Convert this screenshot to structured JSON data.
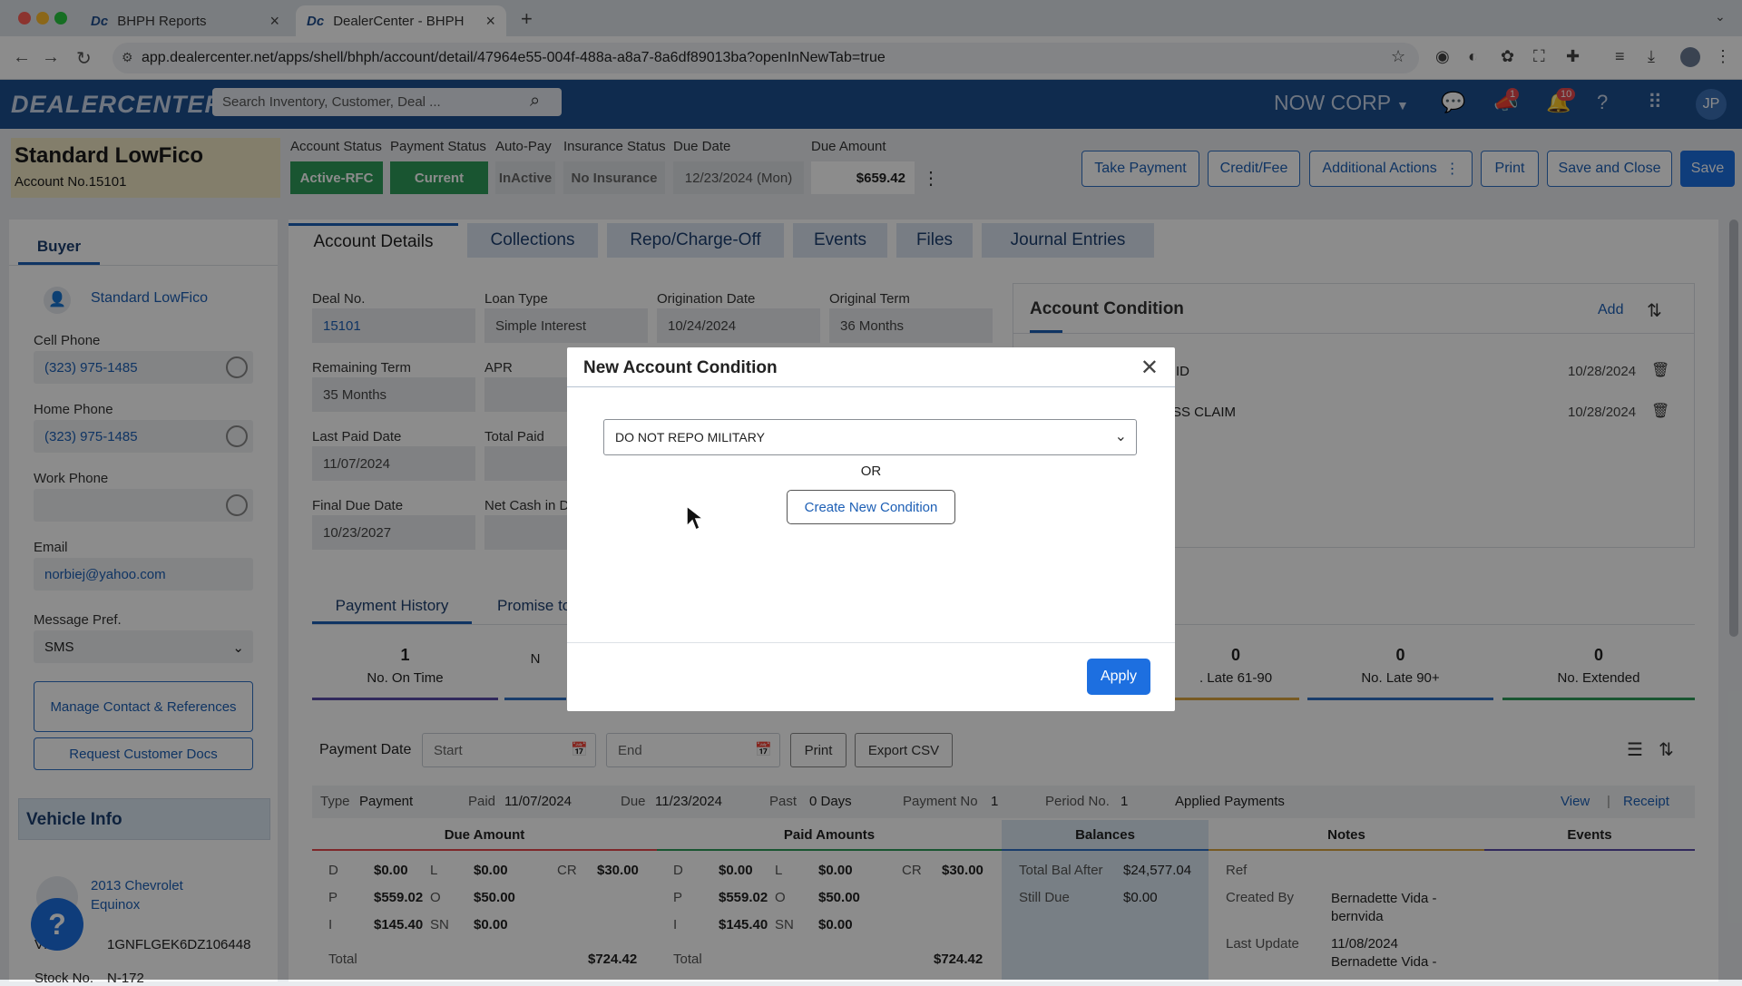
{
  "browser": {
    "tabs": [
      {
        "label": "BHPH Reports",
        "favicon": "Dc"
      },
      {
        "label": "DealerCenter - BHPH",
        "favicon": "Dc"
      }
    ],
    "url": "app.dealercenter.net/apps/shell/bhph/account/detail/47964e55-004f-488a-a8a7-8a6df89013ba?openInNewTab=true"
  },
  "app": {
    "logo": "DEALERCENTER",
    "search_placeholder": "Search Inventory, Customer, Deal ...",
    "company": "NOW CORP",
    "announcements_badge": "1",
    "notifications_badge": "10",
    "user_initials": "JP"
  },
  "account": {
    "name": "Standard LowFico",
    "number_label": "Account No.15101",
    "status_labels": [
      "Account Status",
      "Payment Status",
      "Auto-Pay",
      "Insurance Status",
      "Due Date",
      "Due Amount"
    ],
    "account_status": "Active-RFC",
    "payment_status": "Current",
    "auto_pay": "InActive",
    "insurance_status": "No Insurance",
    "due_date": "12/23/2024 (Mon)",
    "due_amount": "$659.42",
    "actions": [
      "Take Payment",
      "Credit/Fee",
      "Additional Actions",
      "Print",
      "Save and Close",
      "Save"
    ]
  },
  "buyer": {
    "tab": "Buyer",
    "name": "Standard LowFico",
    "cell_label": "Cell Phone",
    "cell": "(323) 975-1485",
    "home_label": "Home Phone",
    "home": "(323) 975-1485",
    "work_label": "Work Phone",
    "work": "",
    "email_label": "Email",
    "email": "norbiej@yahoo.com",
    "msg_label": "Message Pref.",
    "msg": "SMS",
    "manage_btn": "Manage Contact & References",
    "request_btn": "Request Customer Docs",
    "vehicle_title": "Vehicle Info",
    "vehicle": "2013 Chevrolet Equinox",
    "vin_label": "VIN",
    "vin": "1GNFLGEK6DZ106448",
    "stock_label": "Stock No.",
    "stock": "N-172"
  },
  "main": {
    "tabs": [
      "Account Details",
      "Collections",
      "Repo/Charge-Off",
      "Events",
      "Files",
      "Journal Entries"
    ],
    "fields": {
      "deal_no_label": "Deal No.",
      "deal_no": "15101",
      "loan_type_label": "Loan Type",
      "loan_type": "Simple Interest",
      "orig_label": "Origination Date",
      "orig": "10/24/2024",
      "term_label": "Original Term",
      "term": "36 Months",
      "rem_label": "Remaining Term",
      "rem": "35 Months",
      "apr_label": "APR",
      "last_paid_label": "Last Paid Date",
      "last_paid": "11/07/2024",
      "total_paid_label": "Total Paid",
      "final_due_label": "Final Due Date",
      "final_due": "10/23/2027",
      "net_cash_label": "Net Cash in D"
    },
    "condition": {
      "title": "Account Condition",
      "add": "Add",
      "rows": [
        {
          "text": "ID",
          "date": "10/28/2024"
        },
        {
          "text": "SS CLAIM",
          "date": "10/28/2024"
        }
      ]
    },
    "subtabs": [
      "Payment History",
      "Promise to"
    ],
    "stats": [
      {
        "value": "1",
        "label": "No. On Time"
      },
      {
        "value": "",
        "label": "N"
      },
      {
        "value": "0",
        "label": ". Late 61-90"
      },
      {
        "value": "0",
        "label": "No. Late 90+"
      },
      {
        "value": "0",
        "label": "No. Extended"
      }
    ],
    "filter": {
      "label": "Payment Date",
      "start": "Start",
      "end": "End",
      "print": "Print",
      "export": "Export CSV"
    },
    "payment": {
      "type_label": "Type",
      "type": "Payment",
      "paid_label": "Paid",
      "paid": "11/07/2024",
      "due_label": "Due",
      "due": "11/23/2024",
      "past_label": "Past",
      "past": "0 Days",
      "payno_label": "Payment No",
      "payno": "1",
      "period_label": "Period No.",
      "period": "1",
      "applied": "Applied Payments",
      "view": "View",
      "receipt": "Receipt"
    },
    "table": {
      "headers": [
        "Due Amount",
        "Paid Amounts",
        "Balances",
        "Notes",
        "Events"
      ],
      "due": [
        [
          "D",
          "$0.00",
          "L",
          "$0.00",
          "CR",
          "$30.00"
        ],
        [
          "P",
          "$559.02",
          "O",
          "$50.00",
          "",
          ""
        ],
        [
          "I",
          "$145.40",
          "SN",
          "$0.00",
          "",
          ""
        ]
      ],
      "paid": [
        [
          "D",
          "$0.00",
          "L",
          "$0.00",
          "CR",
          "$30.00"
        ],
        [
          "P",
          "$559.02",
          "O",
          "$50.00",
          "",
          ""
        ],
        [
          "I",
          "$145.40",
          "SN",
          "$0.00",
          "",
          ""
        ]
      ],
      "total_label": "Total",
      "due_total": "$724.42",
      "paid_total": "$724.42",
      "bal_after_label": "Total Bal After",
      "bal_after": "$24,577.04",
      "still_due_label": "Still Due",
      "still_due": "$0.00",
      "ref_label": "Ref",
      "created_label": "Created By",
      "created": "Bernadette Vida - bernvida",
      "update_label": "Last Update",
      "update_date": "11/08/2024",
      "update_by": "Bernadette Vida -"
    }
  },
  "modal": {
    "title": "New Account Condition",
    "selected": "DO NOT REPO MILITARY",
    "or": "OR",
    "create": "Create New Condition",
    "apply": "Apply"
  },
  "colors": {
    "brand": "#1d4f8f",
    "accent": "#1d6fe0",
    "status_green": "#2e9b5a"
  }
}
